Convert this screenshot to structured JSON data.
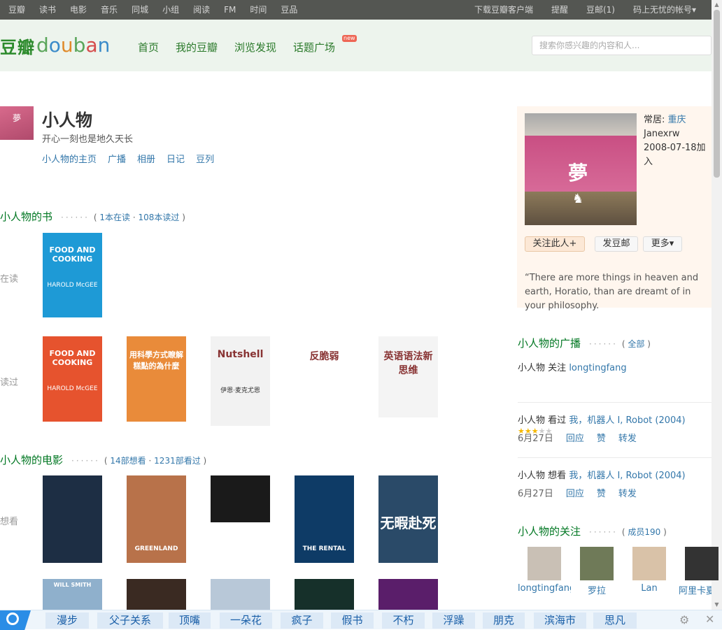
{
  "topbar": {
    "left": [
      "豆瓣",
      "读书",
      "电影",
      "音乐",
      "同城",
      "小组",
      "阅读",
      "FM",
      "时间",
      "豆品"
    ],
    "right": [
      "下载豆瓣客户端",
      "提醒",
      "豆邮(1)",
      "码上无忧的帐号▾"
    ]
  },
  "header": {
    "logo_cn": "豆瓣",
    "logo_en": "douban",
    "nav": [
      "首页",
      "我的豆瓣",
      "浏览发现",
      "话题广场"
    ],
    "new_badge": "new",
    "search_placeholder": "搜索你感兴趣的内容和人..."
  },
  "profile": {
    "avatar_char": "夢",
    "name": "小人物",
    "signature": "开心一刻也是地久天长",
    "links": [
      "小人物的主页",
      "广播",
      "相册",
      "日记",
      "豆列"
    ]
  },
  "books": {
    "title": "小人物的书",
    "meta_reading": "1本在读",
    "meta_sep": "·",
    "meta_read": "108本读过",
    "reading_label": "在读",
    "read_label": "读过",
    "covers": [
      {
        "t": "FOOD AND COOKING",
        "sub": "HAROLD McGEE",
        "bg": "#1e9ad6"
      },
      {
        "t": "FOOD AND COOKING",
        "sub": "HAROLD McGEE",
        "bg": "#e6532e"
      },
      {
        "t": "用科學方式瞭解糕點的為什麼",
        "sub": "",
        "bg": "#e98b3a"
      },
      {
        "t": "Nutshell",
        "sub": "伊恩·麦克尤恩",
        "bg": "#f2f2f2"
      },
      {
        "t": "反脆弱",
        "sub": "",
        "bg": "#ffffff"
      },
      {
        "t": "英语语法新思维",
        "sub": "",
        "bg": "#f4f4f4"
      }
    ]
  },
  "movies": {
    "title": "小人物的电影",
    "meta_want": "14部想看",
    "meta_sep": "·",
    "meta_seen": "1231部看过",
    "want_label": "想看",
    "covers": [
      {
        "t": "",
        "bg": "#1d2e44"
      },
      {
        "t": "GREENLAND",
        "bg": "#b8724a"
      },
      {
        "t": "",
        "bg": "#1a1a1a"
      },
      {
        "t": "THE RENTAL",
        "bg": "#0e3b66"
      },
      {
        "t": "无暇赴死",
        "bg": "#2a4a68"
      }
    ],
    "row2": [
      {
        "t": "WILL SMITH",
        "bg": "#8fb0cc"
      },
      {
        "t": "",
        "bg": "#3a2a22"
      },
      {
        "t": "",
        "bg": "#b8c8d8"
      },
      {
        "t": "",
        "bg": "#16302a"
      },
      {
        "t": "",
        "bg": "#5a1e6a"
      }
    ]
  },
  "info": {
    "city_label": "常居:",
    "city": "重庆",
    "uid": "Janexrw",
    "joined": "2008-07-18加入",
    "follow": "关注此人+",
    "message": "发豆邮",
    "more": "更多▾",
    "quote": "“There are more things in heaven and earth, Horatio, than are dreamt of in your philosophy."
  },
  "broadcast": {
    "title": "小人物的广播",
    "all": "全部",
    "items": [
      {
        "user": "小人物",
        "action": "关注",
        "target": "longtingfang"
      },
      {
        "user": "小人物",
        "action": "看过",
        "target": "我，机器人 I, Robot (2004)",
        "stars": 3,
        "date": "6月27日",
        "reply": "回应",
        "like": "赞",
        "share": "转发"
      },
      {
        "user": "小人物",
        "action": "想看",
        "target": "我，机器人 I, Robot (2004)",
        "date": "6月27日",
        "reply": "回应",
        "like": "赞",
        "share": "转发"
      }
    ]
  },
  "following": {
    "title": "小人物的关注",
    "count": "成员190",
    "people": [
      {
        "name": "longtingfang",
        "bg": "#c9c0b5"
      },
      {
        "name": "罗拉",
        "bg": "#6f7a58"
      },
      {
        "name": "Lan",
        "bg": "#d9c2a8"
      },
      {
        "name": "阿里卡夏",
        "bg": "#333333"
      }
    ]
  },
  "bottombar": {
    "tags": [
      "漫步",
      "父子关系",
      "顶嘴",
      "一朵花",
      "疯子",
      "假书",
      "不朽",
      "浮躁",
      "朋克",
      "滨海市",
      "思凡"
    ]
  },
  "colors": {
    "accent_green": "#072",
    "link_blue": "#37a",
    "topbar": "#545652"
  }
}
